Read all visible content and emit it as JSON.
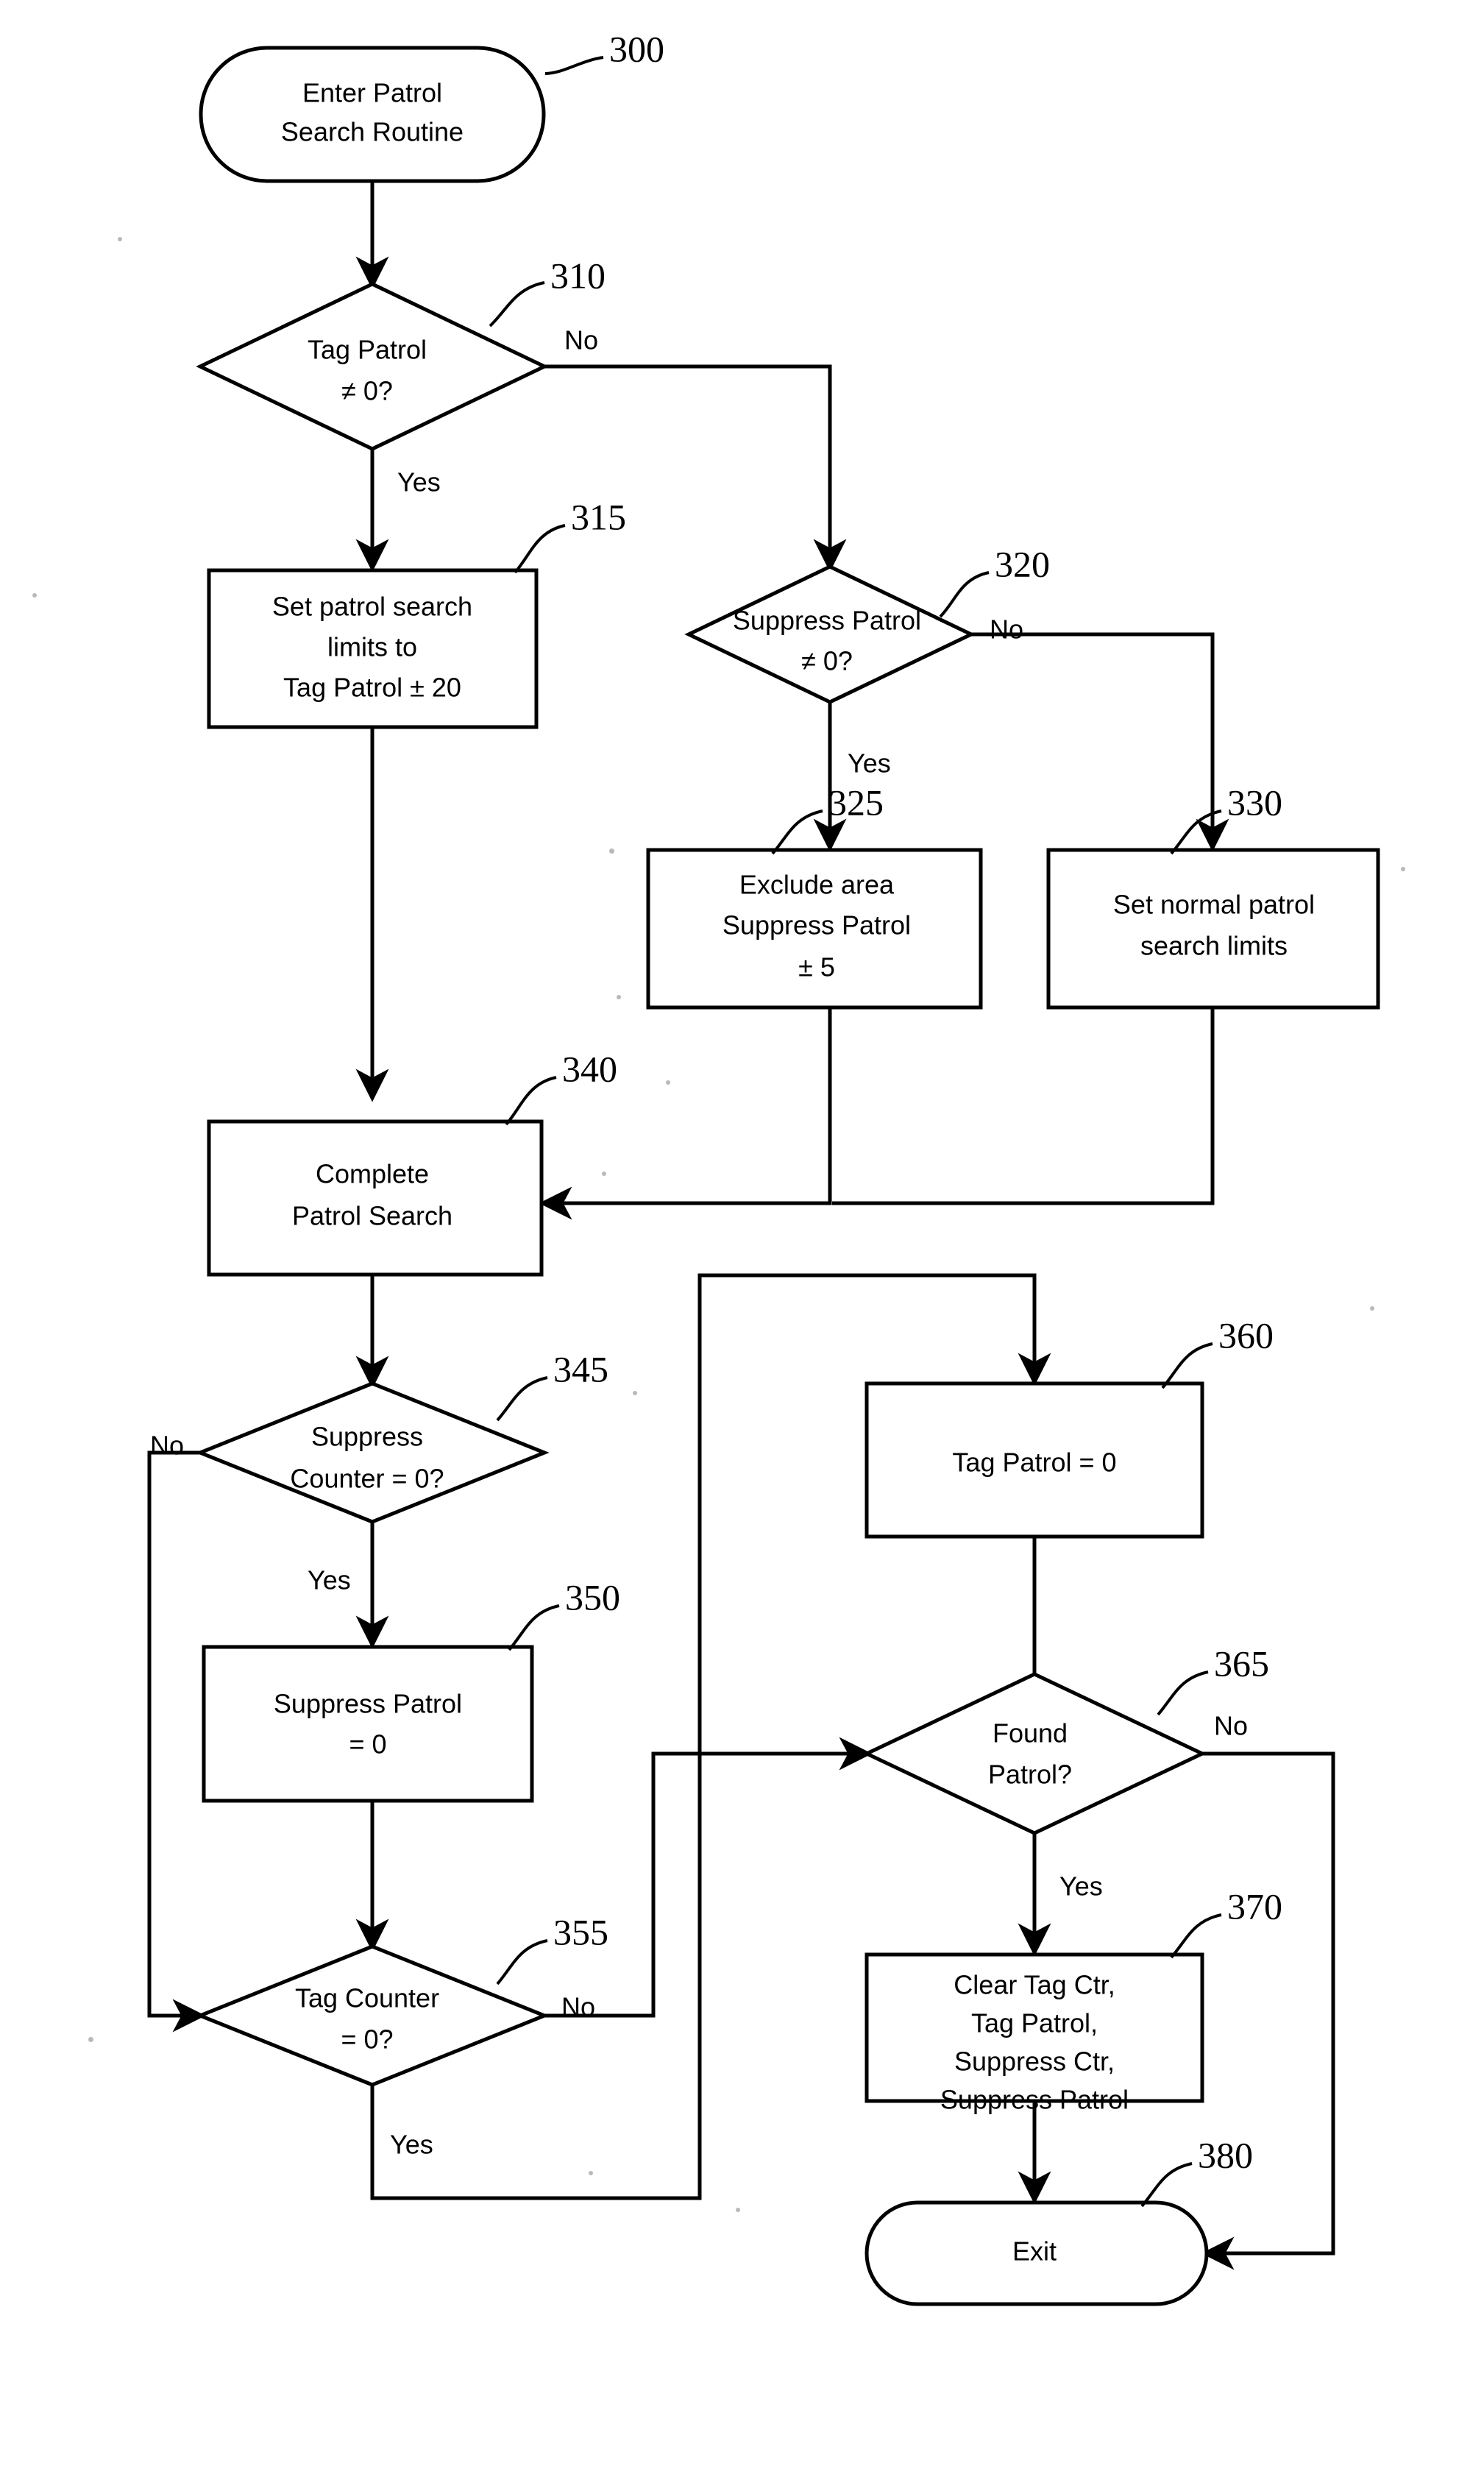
{
  "figure": {
    "type": "flowchart",
    "title": "Patrol Search Routine flowchart",
    "line_color": "#000000",
    "background_color": "#ffffff"
  },
  "nodes": {
    "n300": {
      "ref": "300",
      "shape": "terminator",
      "lines": [
        "Enter Patrol",
        "Search Routine"
      ]
    },
    "n310": {
      "ref": "310",
      "shape": "decision",
      "lines": [
        "Tag Patrol",
        "≠ 0?"
      ]
    },
    "n315": {
      "ref": "315",
      "shape": "process",
      "lines": [
        "Set patrol search",
        "limits to",
        "Tag Patrol ± 20"
      ]
    },
    "n320": {
      "ref": "320",
      "shape": "decision",
      "lines": [
        "Suppress Patrol",
        "≠ 0?"
      ]
    },
    "n325": {
      "ref": "325",
      "shape": "process",
      "lines": [
        "Exclude area",
        "Suppress Patrol",
        "± 5"
      ]
    },
    "n330": {
      "ref": "330",
      "shape": "process",
      "lines": [
        "Set normal patrol",
        "search limits"
      ]
    },
    "n340": {
      "ref": "340",
      "shape": "process",
      "lines": [
        "Complete",
        "Patrol Search"
      ]
    },
    "n345": {
      "ref": "345",
      "shape": "decision",
      "lines": [
        "Suppress",
        "Counter = 0?"
      ]
    },
    "n350": {
      "ref": "350",
      "shape": "process",
      "lines": [
        "Suppress Patrol",
        "= 0"
      ]
    },
    "n355": {
      "ref": "355",
      "shape": "decision",
      "lines": [
        "Tag Counter",
        "= 0?"
      ]
    },
    "n360": {
      "ref": "360",
      "shape": "process",
      "lines": [
        "Tag Patrol = 0"
      ]
    },
    "n365": {
      "ref": "365",
      "shape": "decision",
      "lines": [
        "Found",
        "Patrol?"
      ]
    },
    "n370": {
      "ref": "370",
      "shape": "process",
      "lines": [
        "Clear Tag Ctr,",
        "Tag Patrol,",
        "Suppress Ctr,",
        "Suppress Patrol"
      ]
    },
    "n380": {
      "ref": "380",
      "shape": "terminator",
      "lines": [
        "Exit"
      ]
    }
  },
  "edge_labels": {
    "e310_no": "No",
    "e310_yes": "Yes",
    "e320_no": "No",
    "e320_yes": "Yes",
    "e345_no": "No",
    "e345_yes": "Yes",
    "e355_no": "No",
    "e355_yes": "Yes",
    "e365_no": "No",
    "e365_yes": "Yes"
  }
}
